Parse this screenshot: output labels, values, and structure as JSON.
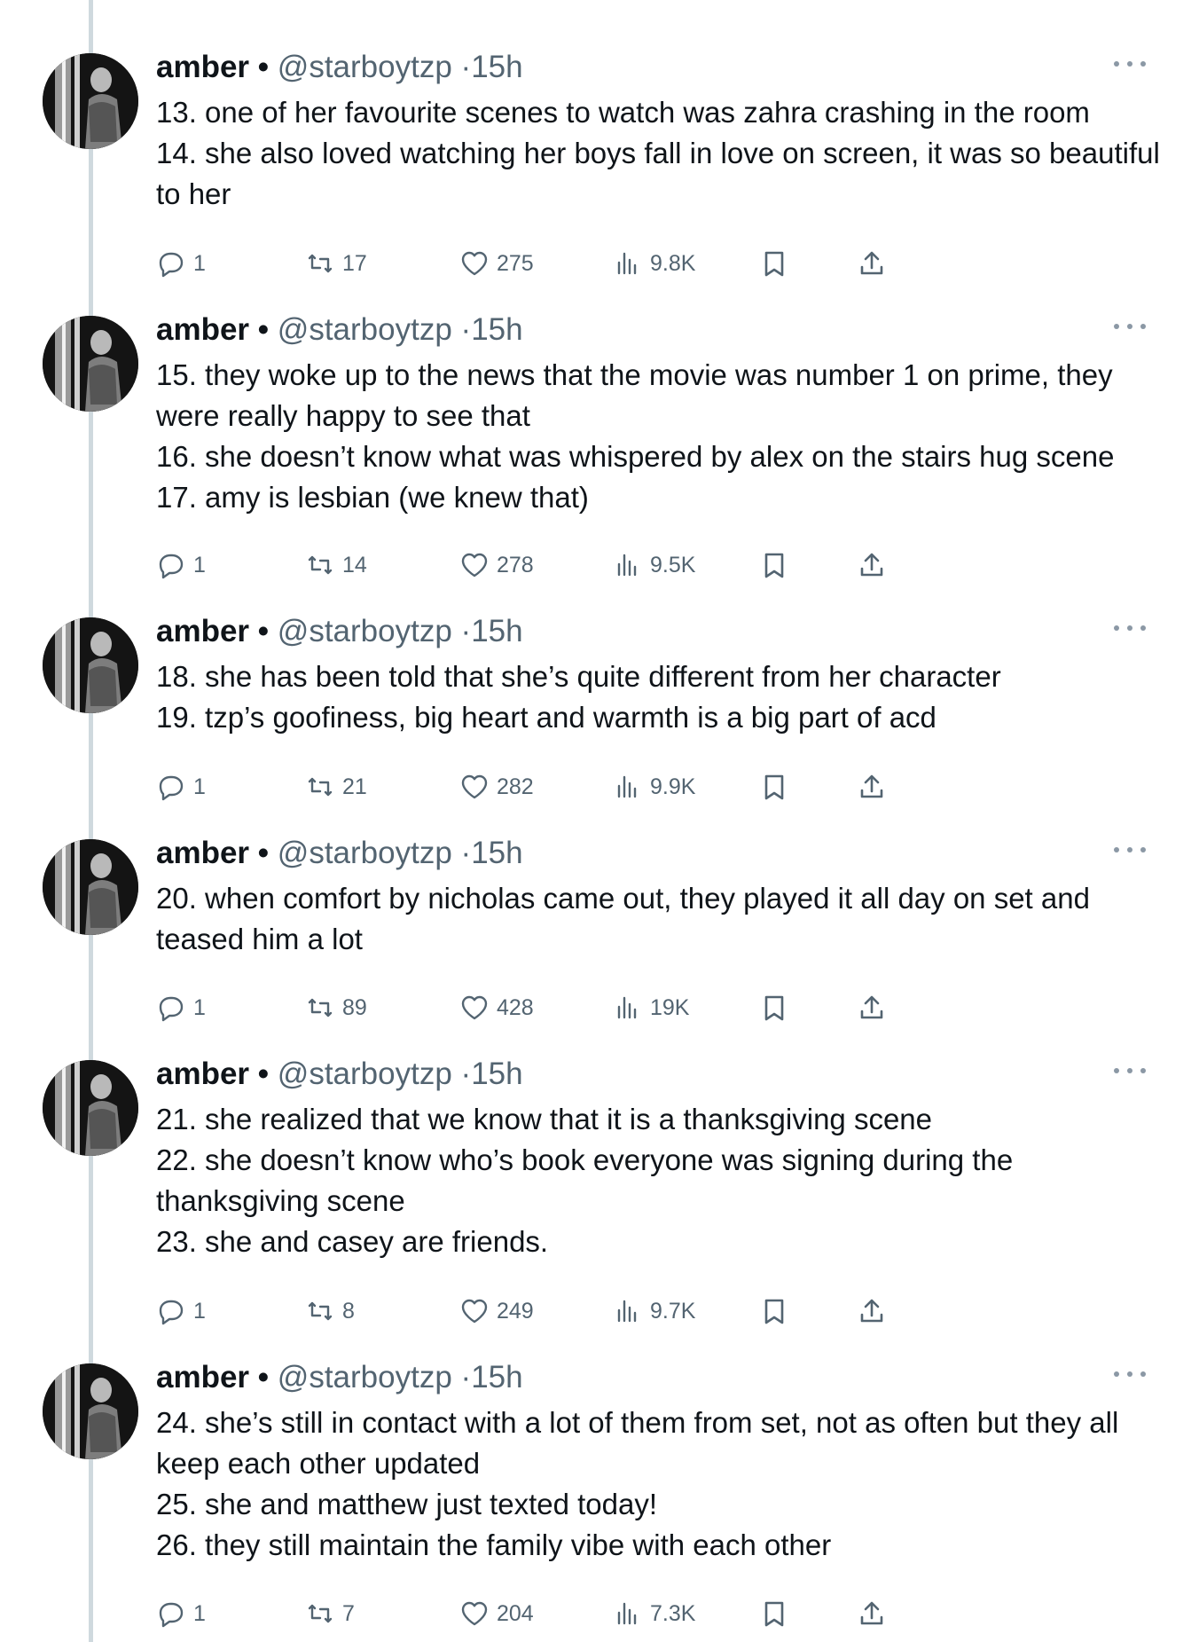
{
  "tweets": [
    {
      "name": "amber",
      "dot": "•",
      "handle": "@starboytzp",
      "sep": "·",
      "time": "15h",
      "lines": [
        "13. one of her favourite scenes to watch was zahra crashing in the room",
        "14. she also loved watching her boys fall in love on screen, it was so beautiful to her"
      ],
      "replies": "1",
      "retweets": "17",
      "likes": "275",
      "views": "9.8K"
    },
    {
      "name": "amber",
      "dot": "•",
      "handle": "@starboytzp",
      "sep": "·",
      "time": "15h",
      "lines": [
        "15. they woke up to the news that the movie was number 1 on prime, they were really happy to see that",
        "16. she doesn’t know what was whispered by alex on the stairs hug scene",
        "17. amy is lesbian (we knew that)"
      ],
      "replies": "1",
      "retweets": "14",
      "likes": "278",
      "views": "9.5K"
    },
    {
      "name": "amber",
      "dot": "•",
      "handle": "@starboytzp",
      "sep": "·",
      "time": "15h",
      "lines": [
        "18. she has been told that she’s quite different from her character",
        "19. tzp’s goofiness, big heart and warmth is a big part of acd"
      ],
      "replies": "1",
      "retweets": "21",
      "likes": "282",
      "views": "9.9K"
    },
    {
      "name": "amber",
      "dot": "•",
      "handle": "@starboytzp",
      "sep": "·",
      "time": "15h",
      "lines": [
        "20. when comfort by nicholas came out, they played it all day on set and teased him a lot"
      ],
      "replies": "1",
      "retweets": "89",
      "likes": "428",
      "views": "19K"
    },
    {
      "name": "amber",
      "dot": "•",
      "handle": "@starboytzp",
      "sep": "·",
      "time": "15h",
      "lines": [
        "21. she realized that we know that it is a thanksgiving scene",
        "22. she doesn’t know who’s book everyone was signing during the thanksgiving scene",
        "23. she and casey are friends."
      ],
      "replies": "1",
      "retweets": "8",
      "likes": "249",
      "views": "9.7K"
    },
    {
      "name": "amber",
      "dot": "•",
      "handle": "@starboytzp",
      "sep": "·",
      "time": "15h",
      "lines": [
        "24. she’s still in contact with a lot of them from set, not as often but they all keep each other updated",
        "25. she and matthew just texted today!",
        "26. they still maintain the family vibe with each other"
      ],
      "replies": "1",
      "retweets": "7",
      "likes": "204",
      "views": "7.3K"
    }
  ],
  "icons": {
    "reply": "reply-icon",
    "retweet": "retweet-icon",
    "like": "heart-icon",
    "views": "views-icon",
    "bookmark": "bookmark-icon",
    "share": "share-icon",
    "more": "more-icon"
  }
}
